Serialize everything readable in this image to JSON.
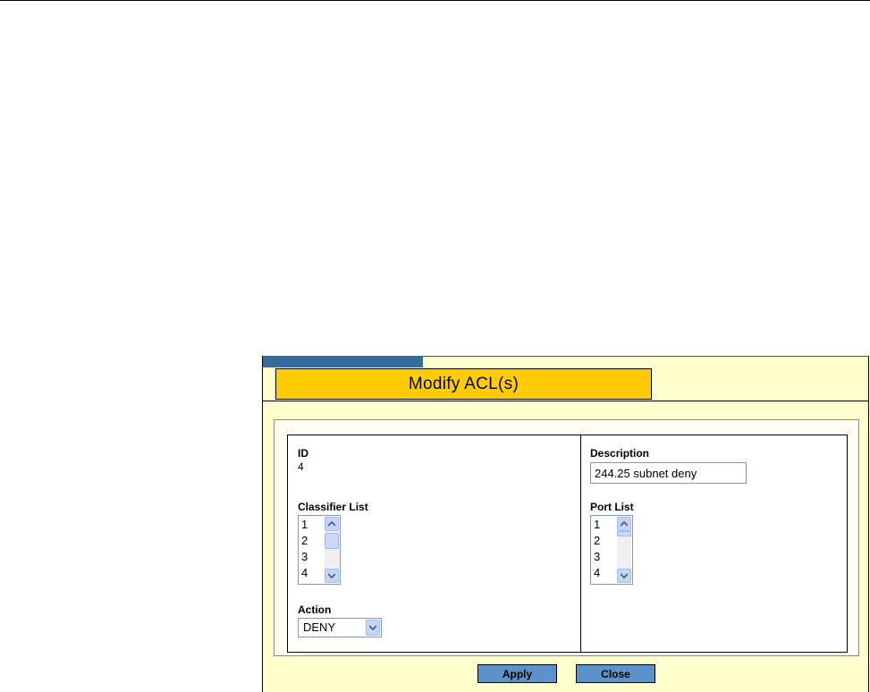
{
  "dialog": {
    "title": "Modify ACL(s)"
  },
  "form": {
    "id": {
      "label": "ID",
      "value": "4"
    },
    "description": {
      "label": "Description",
      "value": "244.25 subnet deny"
    },
    "classifier_list": {
      "label": "Classifier List",
      "items": [
        "1",
        "2",
        "3",
        "4"
      ]
    },
    "port_list": {
      "label": "Port List",
      "items": [
        "1",
        "2",
        "3",
        "4"
      ]
    },
    "action": {
      "label": "Action",
      "selected": "DENY"
    }
  },
  "buttons": {
    "apply": "Apply",
    "close": "Close"
  },
  "colors": {
    "panel_bg": "#ffffcc",
    "title_tab": "#ffcc00",
    "accent_tab": "#3a6a9a",
    "button": "#5b92c9"
  },
  "icons": {
    "scroll_up": "arrow-up-icon",
    "scroll_down": "arrow-down-icon",
    "dropdown": "chevron-down-icon"
  }
}
